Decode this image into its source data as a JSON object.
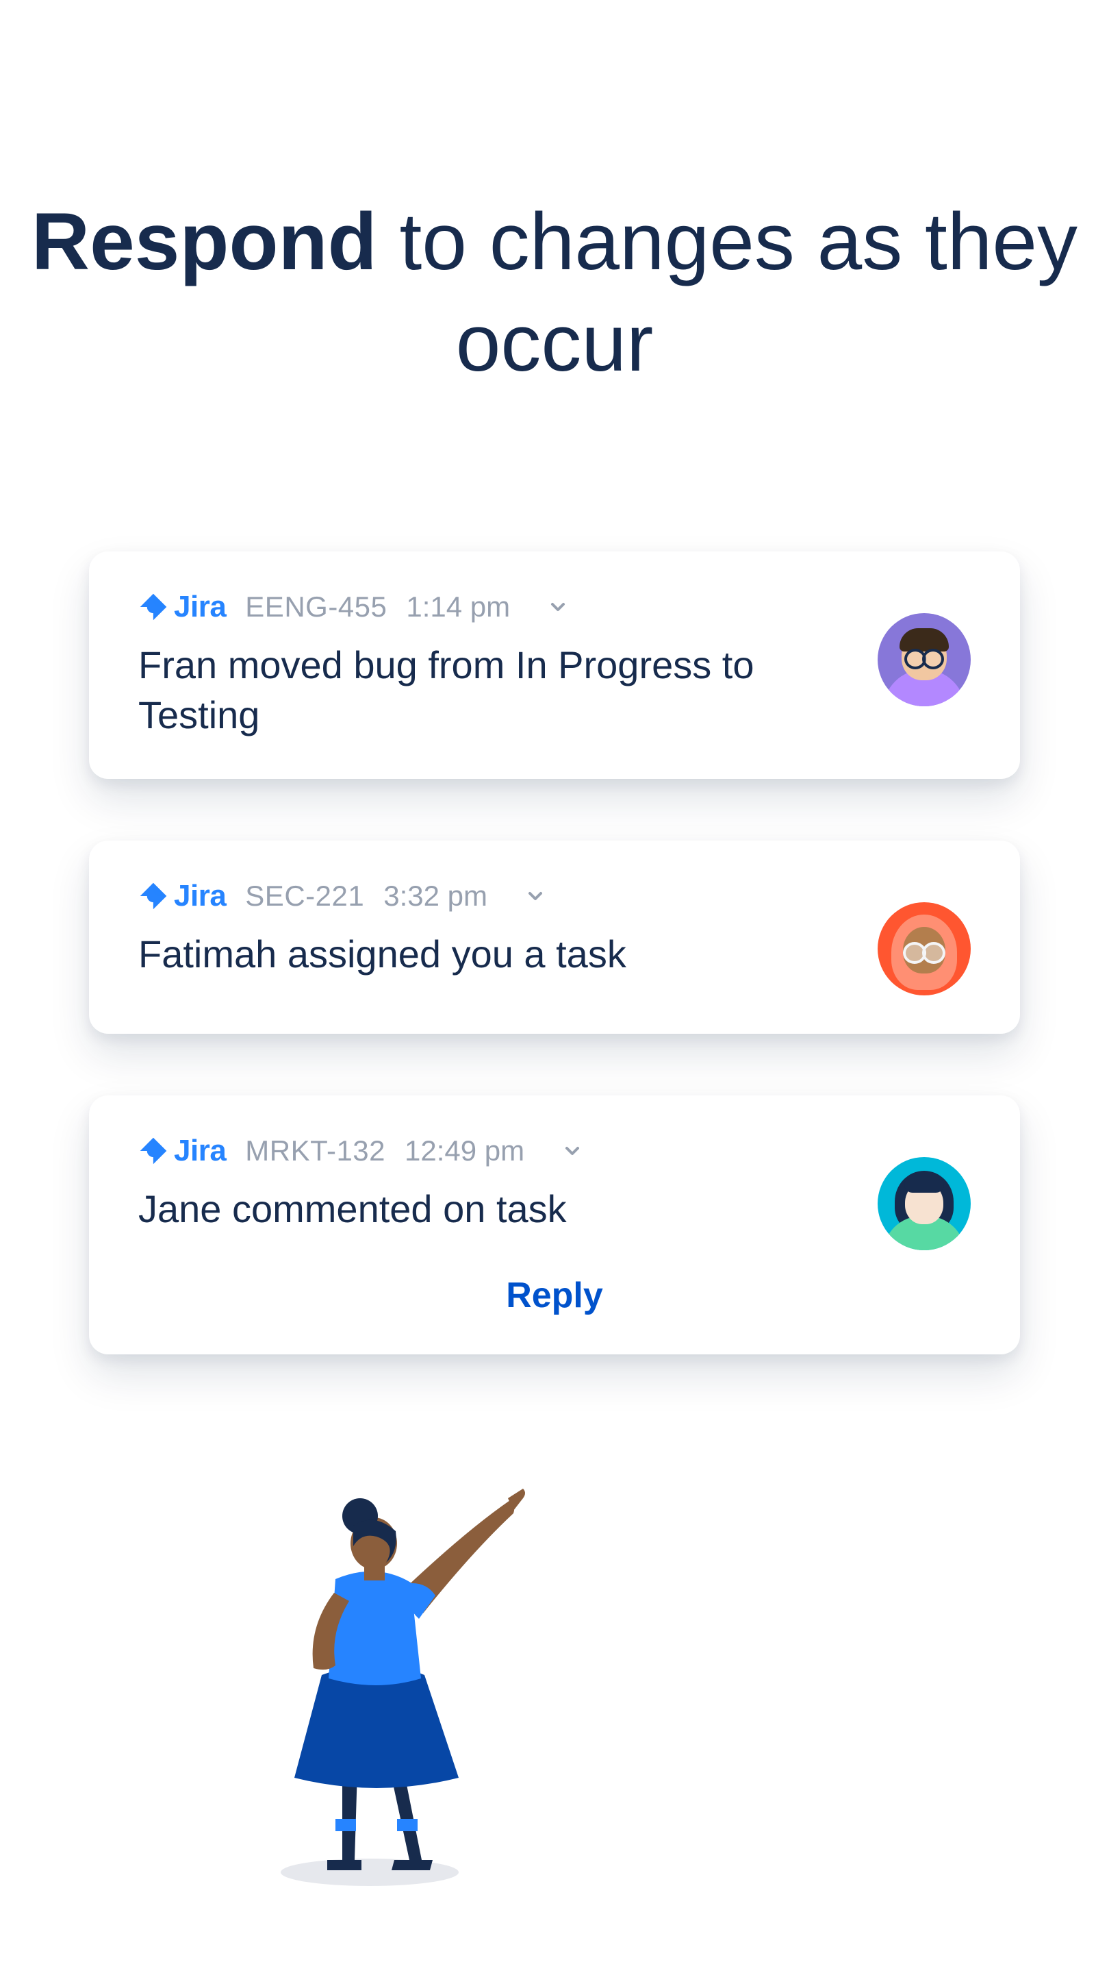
{
  "headline": {
    "bold": "Respond",
    "rest": " to changes as they occur"
  },
  "colors": {
    "brand": "#2684FF",
    "primary": "#0052CC",
    "text": "#172B4D",
    "muted": "#97A0AF"
  },
  "cards": [
    {
      "app": "Jira",
      "ticket": "EENG-455",
      "time": "1:14 pm",
      "message": "Fran moved bug from In Progress to Testing",
      "avatar": "fran"
    },
    {
      "app": "Jira",
      "ticket": "SEC-221",
      "time": "3:32 pm",
      "message": "Fatimah assigned you a task",
      "avatar": "fatimah"
    },
    {
      "app": "Jira",
      "ticket": "MRKT-132",
      "time": "12:49 pm",
      "message": "Jane commented on task",
      "avatar": "jane",
      "action_label": "Reply"
    }
  ]
}
